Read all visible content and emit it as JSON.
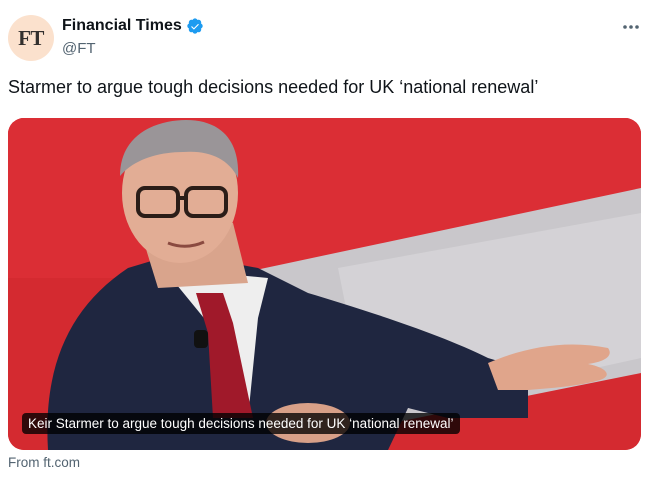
{
  "author": {
    "avatar_text": "FT",
    "display_name": "Financial Times",
    "handle": "@FT",
    "verified": true
  },
  "icons": {
    "verified": "verified-badge-icon",
    "more": "more-options-icon"
  },
  "tweet": {
    "text": "Starmer to argue tough decisions needed for UK ‘national renewal’"
  },
  "card": {
    "image_caption": "Keir Starmer to argue tough decisions needed for UK ‘national renewal’",
    "source": "From ft.com"
  },
  "colors": {
    "avatar_bg": "#fbe1cd",
    "verified_blue": "#1d9bf0",
    "secondary_text": "#536471",
    "backdrop_red": "#d7262d"
  }
}
